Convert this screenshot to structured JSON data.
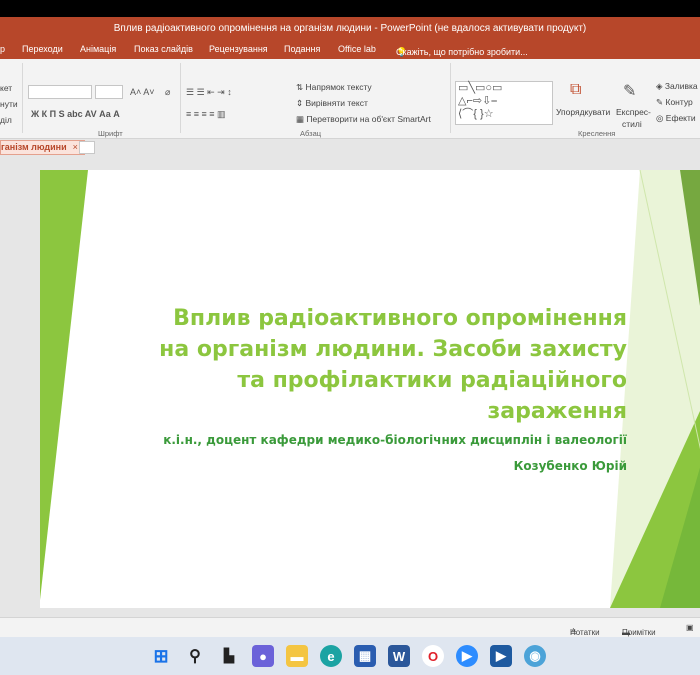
{
  "window": {
    "title": "Вплив радіоактивного опромінення на організм людини - PowerPoint (не вдалося активувати продукт)"
  },
  "ribbon_tabs": [
    {
      "label": "р"
    },
    {
      "label": "Переходи"
    },
    {
      "label": "Анімація"
    },
    {
      "label": "Показ слайдів"
    },
    {
      "label": "Рецензування"
    },
    {
      "label": "Подання"
    },
    {
      "label": "Office lab"
    },
    {
      "label": "Скажіть, що потрібно зробити..."
    }
  ],
  "ribbon": {
    "clipboard": {
      "item1": "кет",
      "item2": "нути",
      "item3": "діл"
    },
    "font": {
      "group_label": "Шрифт",
      "buttons": "Ж К П S abc AV Аа А"
    },
    "paragraph": {
      "group_label": "Абзац",
      "text_direction": "Напрямок тексту",
      "align_text": "Вирівняти текст",
      "smartart": "Перетворити на об'єкт SmartArt"
    },
    "drawing": {
      "group_label": "Креслення",
      "arrange": "Упорядкувати",
      "quick_styles_1": "Експрес-",
      "quick_styles_2": "стилі",
      "fill": "Заливка",
      "outline": "Контур",
      "effects": "Ефекти"
    }
  },
  "document_tab": {
    "label": "ганізм людини",
    "close": "×"
  },
  "slide": {
    "title_lines": [
      "Вплив радіоактивного опромінення",
      "на організм людини. Засоби захисту",
      "та профілактики радіаційного",
      "зараження"
    ],
    "subtitle_1": "к.і.н., доцент кафедри медико-біологічних дисциплін і валеології",
    "subtitle_2": "Козубенко Юрій"
  },
  "statusbar": {
    "notes": "Нотатки",
    "comments": "Примітки"
  },
  "taskbar": {
    "icons": [
      "windows-start",
      "search",
      "task-view",
      "chat",
      "file-explorer",
      "edge",
      "store",
      "word",
      "opera",
      "zoom",
      "powerpoint",
      "browser"
    ]
  },
  "colors": {
    "accent": "#b7472a",
    "slide_green": "#8cc63f",
    "subtitle_green": "#3a9a3a"
  }
}
